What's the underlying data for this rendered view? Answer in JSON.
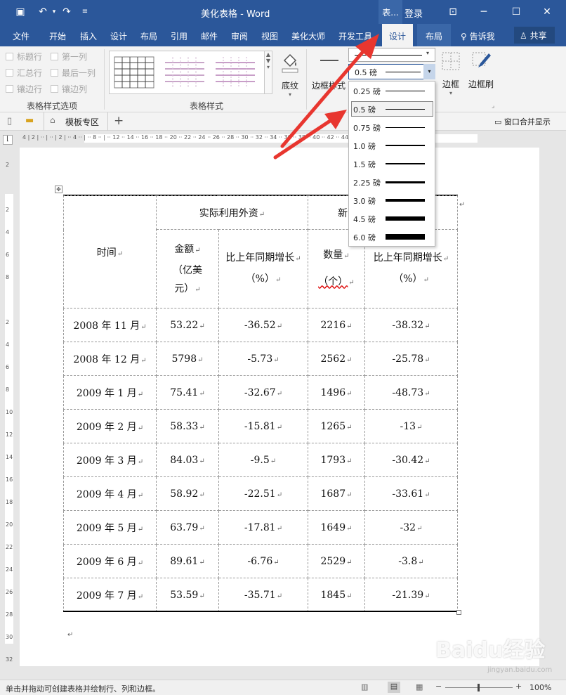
{
  "titlebar": {
    "doc_title": "美化表格  -  Word",
    "ctx_label": "表...",
    "login": "登录"
  },
  "tabs": [
    "文件",
    "开始",
    "插入",
    "设计",
    "布局",
    "引用",
    "邮件",
    "审阅",
    "视图",
    "美化大师",
    "开发工具"
  ],
  "ctx_tabs": {
    "design": "设计",
    "layout": "布局"
  },
  "tell_me": "告诉我",
  "share": "共享",
  "ribbon": {
    "options": {
      "header_row": "标题行",
      "first_col": "第一列",
      "total_row": "汇总行",
      "last_col": "最后一列",
      "banded_rows": "镶边行",
      "banded_cols": "镶边列",
      "group_label": "表格样式选项"
    },
    "styles_group_label": "表格样式",
    "shading": "底纹",
    "border_styles": "边框样式",
    "borders": "边框",
    "border_painter": "边框刷"
  },
  "qbar": {
    "template_tab": "模板专区",
    "merge_label": "窗口合并显示"
  },
  "dropdown": {
    "selected": "0.5 磅",
    "items": [
      {
        "label": "0.25 磅",
        "weight": 1
      },
      {
        "label": "0.5 磅",
        "weight": 1
      },
      {
        "label": "0.75 磅",
        "weight": 1
      },
      {
        "label": "1.0 磅",
        "weight": 1.5
      },
      {
        "label": "1.5 磅",
        "weight": 2
      },
      {
        "label": "2.25 磅",
        "weight": 3
      },
      {
        "label": "3.0 磅",
        "weight": 4
      },
      {
        "label": "4.5 磅",
        "weight": 6
      },
      {
        "label": "6.0 磅",
        "weight": 8
      }
    ]
  },
  "table": {
    "col_time": "时间",
    "group1": "实际利用外资",
    "group2": "新",
    "amount": "金额",
    "amount_unit": "（亿美元）",
    "growth": "比上年同期增长",
    "growth_unit": "（%）",
    "count": "数量",
    "count_unit": "（个）",
    "growth2": "比上年同期增长",
    "growth2_unit": "（%）",
    "rows": [
      {
        "time": "2008 年 11 月",
        "amount": "53.22",
        "growth": "-36.52",
        "count": "2216",
        "growth2": "-38.32"
      },
      {
        "time": "2008 年 12 月",
        "amount": "5798",
        "growth": "-5.73",
        "count": "2562",
        "growth2": "-25.78"
      },
      {
        "time": "2009 年 1 月",
        "amount": "75.41",
        "growth": "-32.67",
        "count": "1496",
        "growth2": "-48.73"
      },
      {
        "time": "2009 年 2 月",
        "amount": "58.33",
        "growth": "-15.81",
        "count": "1265",
        "growth2": "-13"
      },
      {
        "time": "2009 年 3 月",
        "amount": "84.03",
        "growth": "-9.5",
        "count": "1793",
        "growth2": "-30.42"
      },
      {
        "time": "2009 年 4 月",
        "amount": "58.92",
        "growth": "-22.51",
        "count": "1687",
        "growth2": "-33.61"
      },
      {
        "time": "2009 年 5 月",
        "amount": "63.79",
        "growth": "-17.81",
        "count": "1649",
        "growth2": "-32"
      },
      {
        "time": "2009 年 6 月",
        "amount": "89.61",
        "growth": "-6.76",
        "count": "2529",
        "growth2": "-3.8"
      },
      {
        "time": "2009 年 7 月",
        "amount": "53.59",
        "growth": "-35.71",
        "count": "1845",
        "growth2": "-21.39"
      }
    ]
  },
  "status": {
    "message": "单击并拖动可创建表格并绘制行、列和边框。",
    "zoom": "100%"
  },
  "watermark": {
    "brand": "Baidu经验",
    "url": "jingyan.baidu.com"
  },
  "colors": {
    "word_blue": "#2b579a",
    "arrow_red": "#e8362f"
  }
}
